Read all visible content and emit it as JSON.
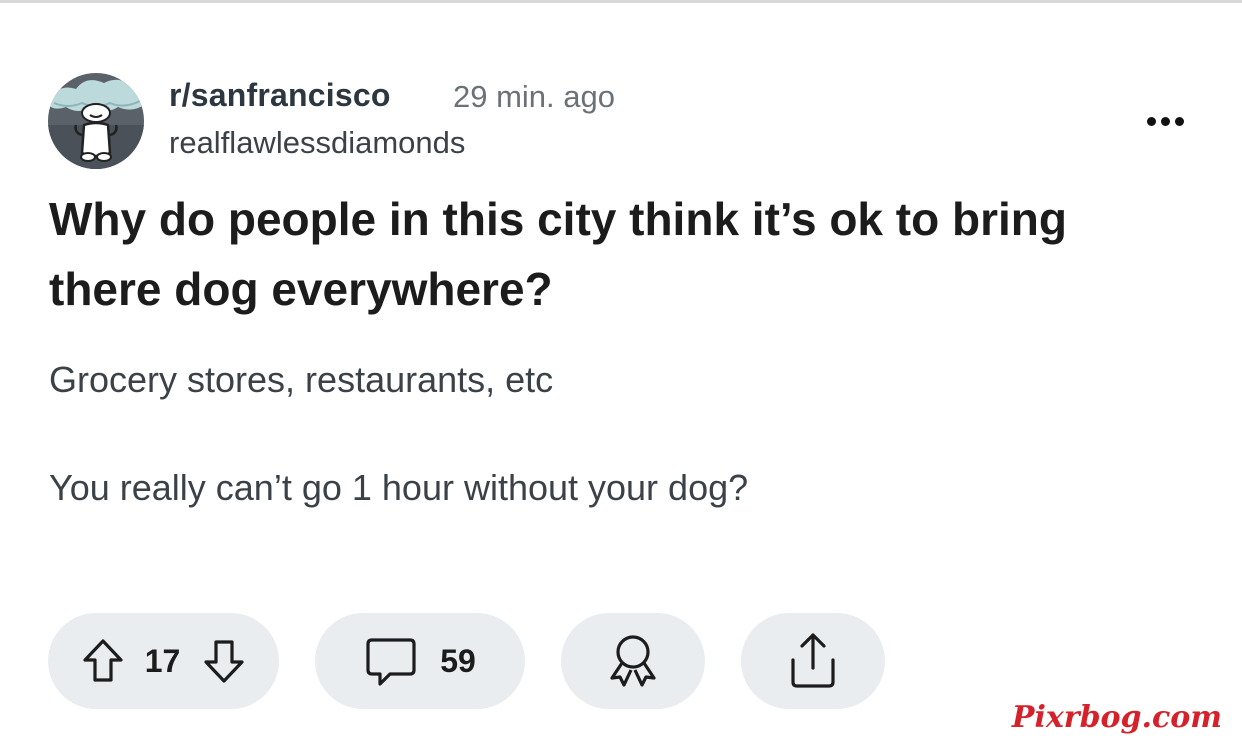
{
  "post": {
    "subreddit": "r/sanfrancisco",
    "time_ago": "29 min. ago",
    "author": "realflawlessdiamonds",
    "title": "Why do people in this city think it’s ok to bring there dog everywhere?",
    "body": [
      "Grocery stores, restaurants, etc",
      "You really can’t go 1 hour without your dog?"
    ]
  },
  "actions": {
    "vote_count": "17",
    "comment_count": "59"
  },
  "icons": {
    "more": "more-options-icon",
    "upvote": "arrow-up-icon",
    "downvote": "arrow-down-icon",
    "comment": "comment-bubble-icon",
    "award": "award-ribbon-icon",
    "share": "share-icon"
  },
  "colors": {
    "pill_background": "#e9edf0",
    "watermark": "#d6202a",
    "avatar_cloud": "#bcd9dc"
  },
  "watermark": "Pixrbog.com"
}
